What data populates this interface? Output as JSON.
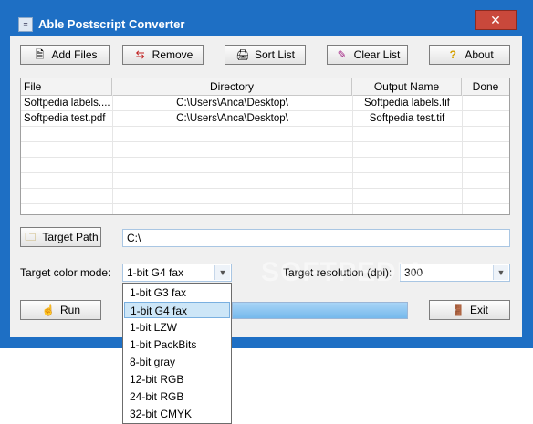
{
  "window": {
    "title": "Able Postscript Converter",
    "close_glyph": "✕"
  },
  "toolbar": {
    "add_files": "Add Files",
    "remove": "Remove",
    "sort_list": "Sort List",
    "clear_list": "Clear List",
    "about": "About"
  },
  "table": {
    "headers": [
      "File",
      "Directory",
      "Output Name",
      "Done"
    ],
    "rows": [
      {
        "file": "Softpedia labels....",
        "directory": "C:\\Users\\Anca\\Desktop\\",
        "output": "Softpedia labels.tif",
        "done": ""
      },
      {
        "file": "Softpedia test.pdf",
        "directory": "C:\\Users\\Anca\\Desktop\\",
        "output": "Softpedia test.tif",
        "done": ""
      }
    ]
  },
  "target_path": {
    "button": "Target Path",
    "value": "C:\\"
  },
  "color_mode": {
    "label": "Target color mode:",
    "value": "1-bit G4 fax",
    "options": [
      "1-bit G3 fax",
      "1-bit G4 fax",
      "1-bit LZW",
      "1-bit PackBits",
      "8-bit gray",
      "12-bit RGB",
      "24-bit RGB",
      "32-bit CMYK"
    ],
    "selected_index": 1
  },
  "resolution": {
    "label": "Target resolution (dpi):",
    "value": "300"
  },
  "actions": {
    "run": "Run",
    "exit": "Exit"
  },
  "watermark": "SOFTPEDIA",
  "colors": {
    "title_bar": "#1e6fc4",
    "close": "#c9483b",
    "selection": "#cde6f7"
  },
  "icons": [
    "app-icon",
    "add-files-icon",
    "remove-icon",
    "sort-list-icon",
    "clear-list-icon",
    "about-icon",
    "folder-icon",
    "run-icon",
    "exit-icon"
  ]
}
